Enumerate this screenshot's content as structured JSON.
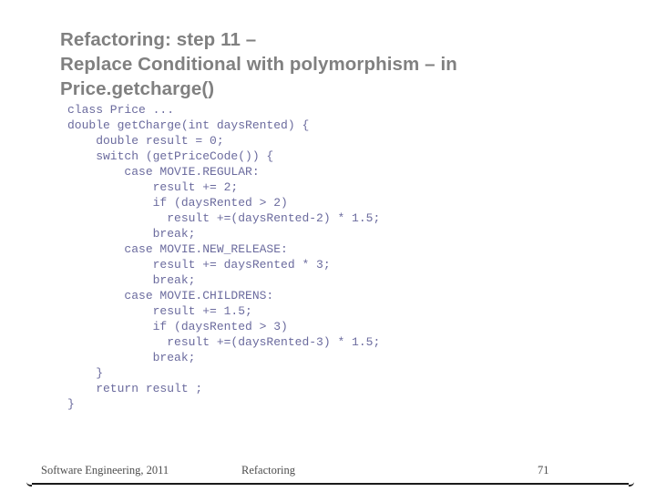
{
  "slide": {
    "title": "Refactoring: step 11 –\nReplace Conditional with polymorphism – in\nPrice.getcharge()",
    "title_color": "#808080",
    "background_color": "#ffffff"
  },
  "code": {
    "language": "java",
    "color": "#6b6b9e",
    "lines": [
      "class Price ...",
      "double getCharge(int daysRented) {",
      "    double result = 0;",
      "    switch (getPriceCode()) {",
      "        case MOVIE.REGULAR:",
      "            result += 2;",
      "            if (daysRented > 2)",
      "              result +=(daysRented-2) * 1.5;",
      "            break;",
      "        case MOVIE.NEW_RELEASE:",
      "            result += daysRented * 3;",
      "            break;",
      "        case MOVIE.CHILDRENS:",
      "            result += 1.5;",
      "            if (daysRented > 3)",
      "              result +=(daysRented-3) * 1.5;",
      "            break;",
      "    }",
      "    return result ;",
      "}"
    ]
  },
  "footer": {
    "left": "Software Engineering, 2011",
    "center": "Refactoring",
    "page_number": "71"
  }
}
